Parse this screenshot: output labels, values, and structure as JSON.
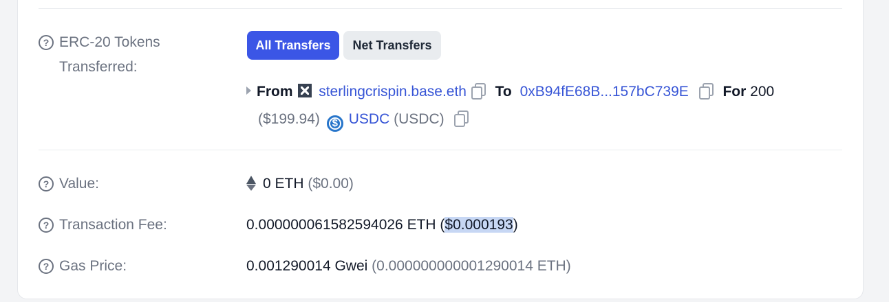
{
  "erc20": {
    "label": "ERC-20 Tokens Transferred:",
    "tabs": {
      "all_transfers": "All Transfers",
      "net_transfers": "Net Transfers"
    },
    "transfer": {
      "from_label": "From",
      "from_address": "sterlingcrispin.base.eth",
      "to_label": "To",
      "to_address": "0xB94fE68B...157bC739E",
      "for_label": "For",
      "amount": "200",
      "usd_value": "($199.94)",
      "token_name": "USDC",
      "token_symbol": "(USDC)"
    }
  },
  "value": {
    "label": "Value:",
    "amount": "0 ETH",
    "usd": "($0.00)"
  },
  "transaction_fee": {
    "label": "Transaction Fee:",
    "amount": "0.000000061582594026 ETH",
    "usd_open": "(",
    "usd_value": "$0.000193",
    "usd_close": ")"
  },
  "gas_price": {
    "label": "Gas Price:",
    "amount": "0.001290014 Gwei",
    "eth_equivalent": "(0.000000000001290014 ETH)"
  },
  "icons": {
    "help": "question-circle-icon",
    "copy": "copy-icon",
    "eth": "ethereum-icon",
    "usdc": "usdc-icon"
  },
  "colors": {
    "accent": "#3b56e6",
    "link": "#3755d6",
    "usdc": "#2775ca",
    "highlight": "#c7d7f4"
  }
}
